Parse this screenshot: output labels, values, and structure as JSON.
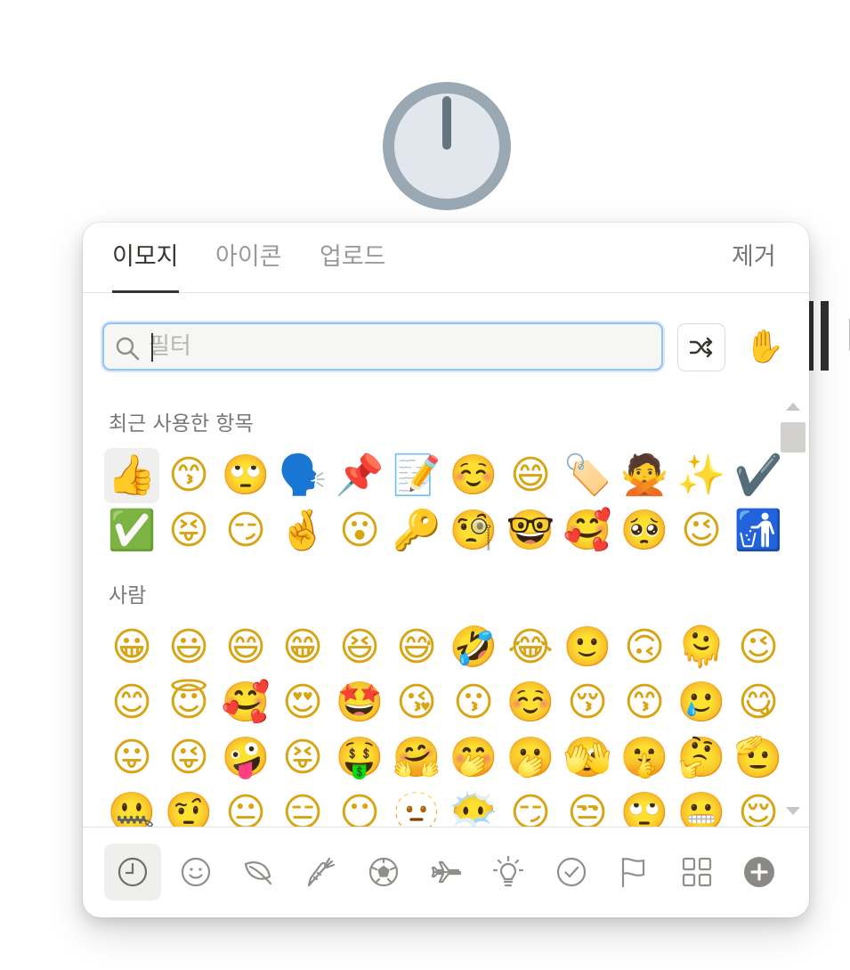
{
  "page": {
    "icon": "clock-twelve-icon",
    "background_text_fragment": "ㅏ"
  },
  "picker": {
    "tabs": [
      {
        "label": "이모지",
        "active": true
      },
      {
        "label": "아이콘",
        "active": false
      },
      {
        "label": "업로드",
        "active": false
      }
    ],
    "remove_label": "제거",
    "search": {
      "placeholder": "필터",
      "value": ""
    },
    "shuffle_icon": "shuffle-icon",
    "skin_tone": {
      "icon": "raised-hand-icon",
      "emoji": "✋"
    },
    "sections": {
      "recent": {
        "title": "최근 사용한 항목",
        "emojis": [
          "👍",
          "😙",
          "🙄",
          "🗣️",
          "📌",
          "📝",
          "☺️",
          "😄",
          "🏷️",
          "🙅",
          "✨",
          "✔️",
          "✅",
          "😝",
          "😏",
          "🤞",
          "😮",
          "🔑",
          "🧐",
          "🤓",
          "🥰",
          "🥺",
          "😉",
          "🚮"
        ]
      },
      "people": {
        "title": "사람",
        "emojis": [
          "😀",
          "😃",
          "😄",
          "😁",
          "😆",
          "😅",
          "🤣",
          "😂",
          "🙂",
          "🙃",
          "🫠",
          "😉",
          "😊",
          "😇",
          "🥰",
          "😍",
          "🤩",
          "😘",
          "😗",
          "☺️",
          "😚",
          "😙",
          "🥲",
          "😋",
          "😛",
          "😜",
          "🤪",
          "😝",
          "🤑",
          "🤗",
          "🤭",
          "🫢",
          "🫣",
          "🤫",
          "🤔",
          "🫡",
          "🤐",
          "🤨",
          "😐",
          "😑",
          "😶",
          "🫥",
          "😶‍🌫️",
          "😏",
          "😒",
          "🙄",
          "😬",
          "😌"
        ]
      }
    },
    "categories": [
      {
        "name": "recent",
        "icon": "clock-icon",
        "active": true
      },
      {
        "name": "people",
        "icon": "smiley-icon",
        "active": false
      },
      {
        "name": "nature",
        "icon": "leaf-icon",
        "active": false
      },
      {
        "name": "food",
        "icon": "carrot-icon",
        "active": false
      },
      {
        "name": "activity",
        "icon": "soccer-ball-icon",
        "active": false
      },
      {
        "name": "travel",
        "icon": "airplane-icon",
        "active": false
      },
      {
        "name": "objects",
        "icon": "lightbulb-icon",
        "active": false
      },
      {
        "name": "symbols",
        "icon": "check-circle-icon",
        "active": false
      },
      {
        "name": "flags",
        "icon": "flag-icon",
        "active": false
      },
      {
        "name": "custom",
        "icon": "grid-icon",
        "active": false
      },
      {
        "name": "add",
        "icon": "plus-circle-icon",
        "active": false
      }
    ],
    "colors": {
      "accent_focus": "#94c2ee",
      "text": "#37352f",
      "muted": "#9b9a97"
    }
  }
}
